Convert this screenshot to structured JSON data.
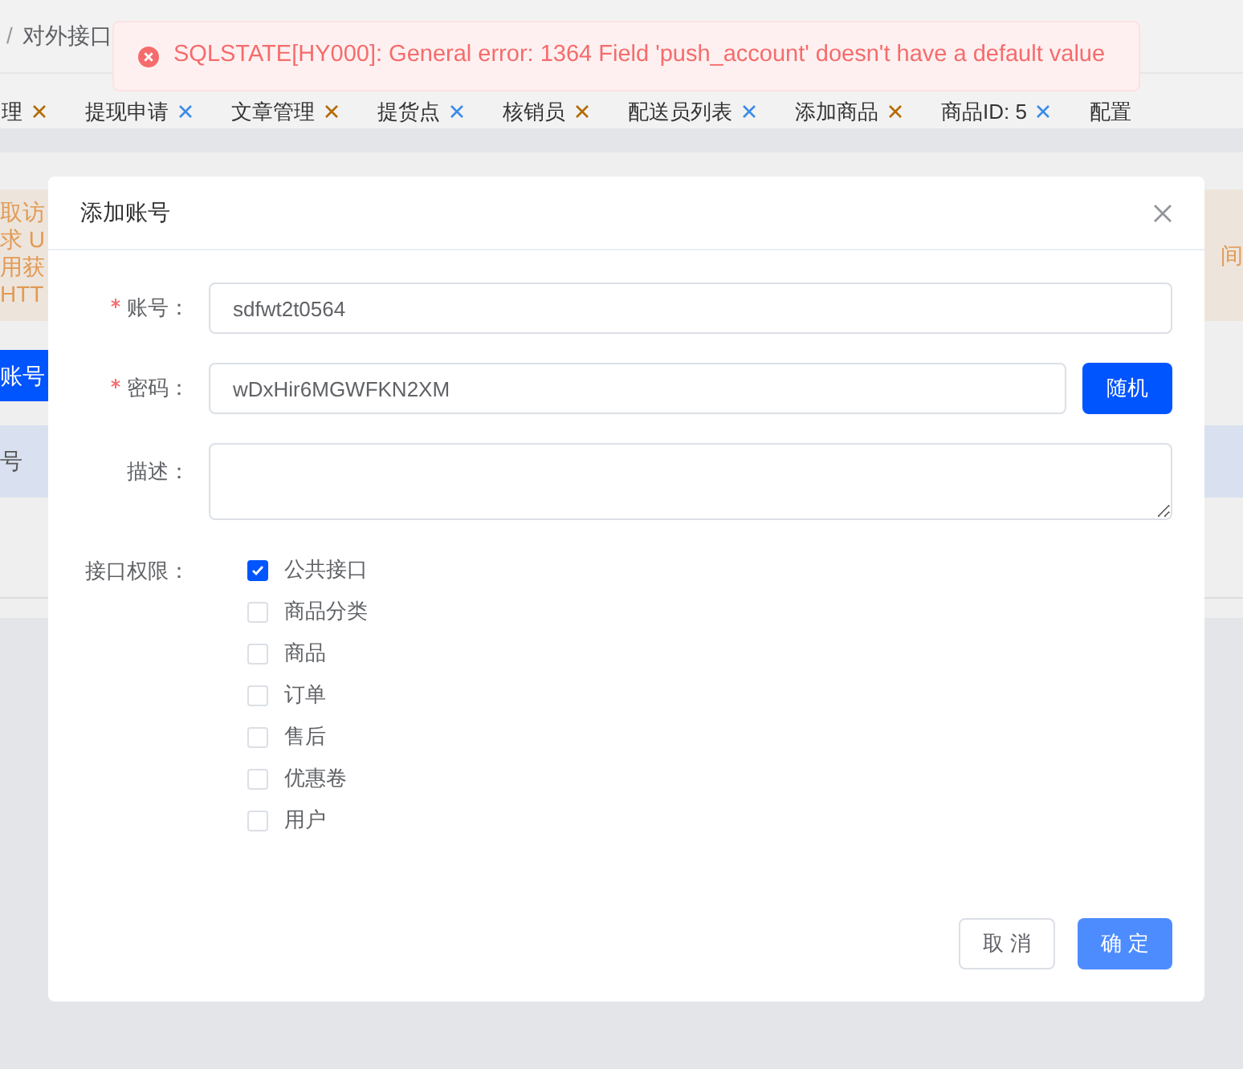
{
  "breadcrumb": {
    "separator": "/",
    "current": "对外接口"
  },
  "tabs": [
    {
      "label": "理"
    },
    {
      "label": "提现申请"
    },
    {
      "label": "文章管理"
    },
    {
      "label": "提货点"
    },
    {
      "label": "核销员"
    },
    {
      "label": "配送员列表"
    },
    {
      "label": "添加商品"
    },
    {
      "label": "商品ID: 5"
    },
    {
      "label": "配置"
    }
  ],
  "background": {
    "notice_lines": [
      "取访",
      "求 U",
      "用获",
      "HTT"
    ],
    "notice_right": "间",
    "add_button": "账号",
    "table_cell": "号"
  },
  "toast": {
    "kind": "error",
    "message": "SQLSTATE[HY000]: General error: 1364 Field 'push_account' doesn't have a default value"
  },
  "dialog": {
    "title": "添加账号",
    "fields": [
      {
        "kind": "input",
        "label": "账号：",
        "required": true,
        "value": "sdfwt2t0564"
      },
      {
        "kind": "input",
        "label": "密码：",
        "required": true,
        "value": "wDxHir6MGWFKN2XM",
        "button": "随机"
      },
      {
        "kind": "textarea",
        "label": "描述：",
        "required": false
      }
    ],
    "permissions": {
      "label": "接口权限：",
      "options": [
        {
          "label": "公共接口",
          "checked": true
        },
        {
          "label": "商品分类",
          "checked": false
        },
        {
          "label": "商品",
          "checked": false
        },
        {
          "label": "订单",
          "checked": false
        },
        {
          "label": "售后",
          "checked": false
        },
        {
          "label": "优惠卷",
          "checked": false
        },
        {
          "label": "用户",
          "checked": false
        }
      ]
    },
    "buttons": [
      {
        "kind": "cancel",
        "label": "取 消"
      },
      {
        "kind": "confirm",
        "label": "确 定"
      }
    ]
  }
}
